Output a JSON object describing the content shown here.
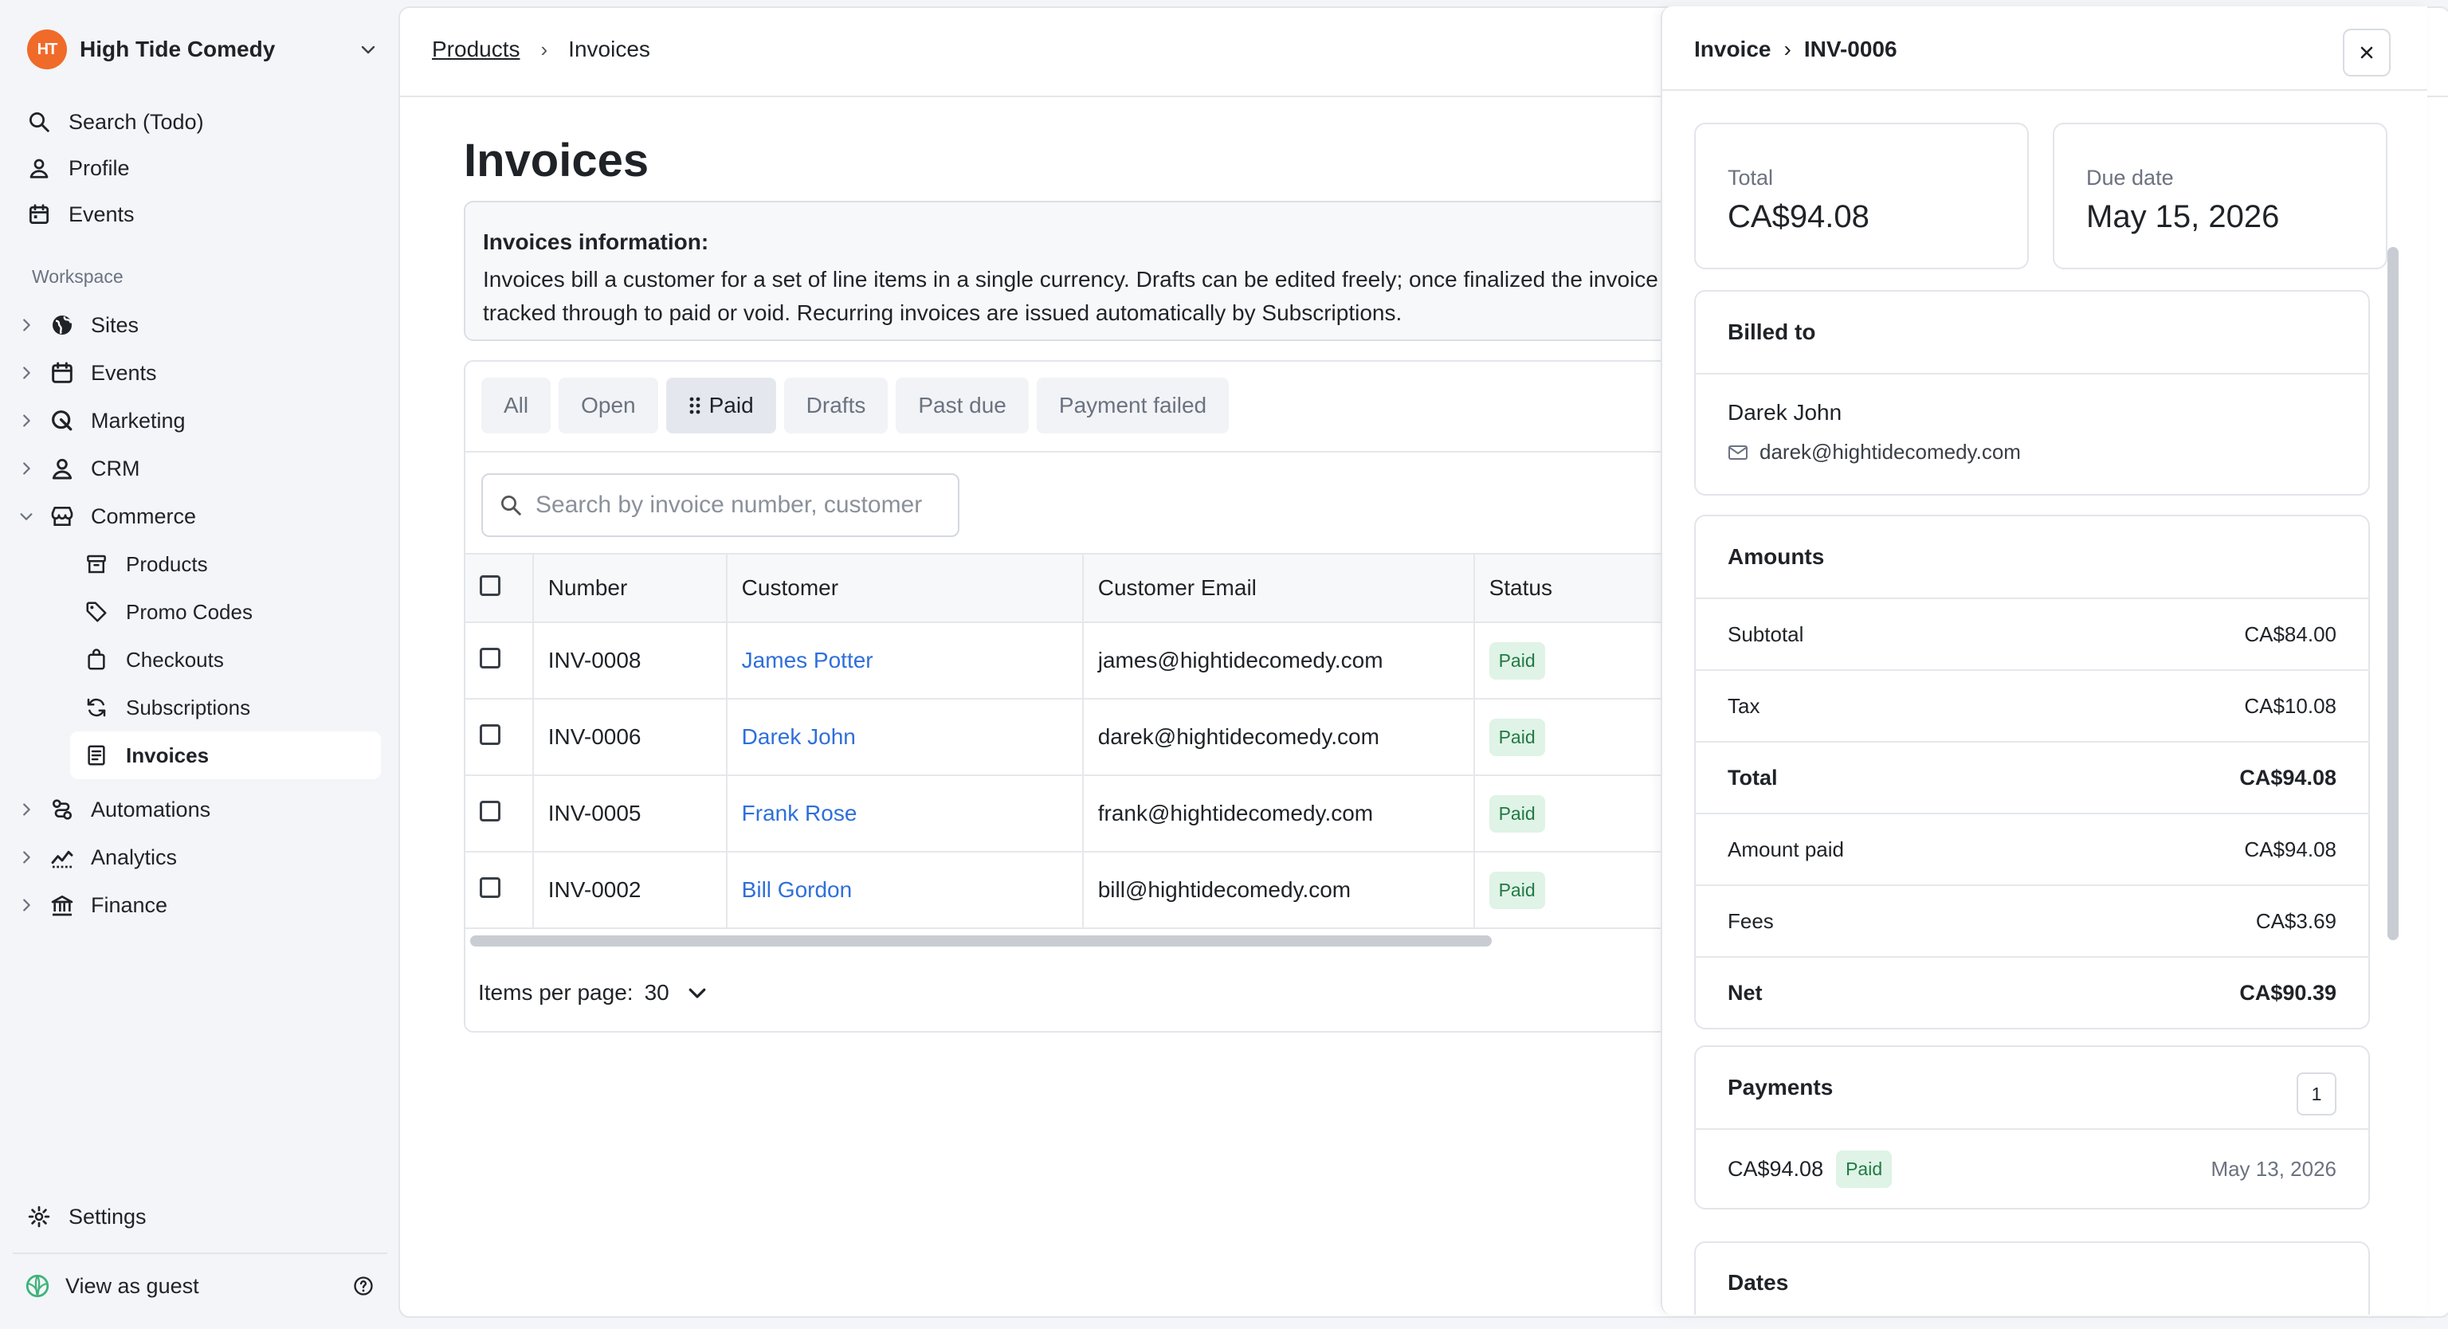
{
  "org": {
    "name": "High Tide Comedy",
    "logo_text": "HT"
  },
  "nav_top": [
    {
      "label": "Search (Todo)",
      "icon": "search-icon"
    },
    {
      "label": "Profile",
      "icon": "user-icon"
    },
    {
      "label": "Events",
      "icon": "calendar-icon"
    }
  ],
  "workspace": {
    "label": "Workspace",
    "items": [
      {
        "label": "Sites",
        "icon": "globe-icon"
      },
      {
        "label": "Events",
        "icon": "calendar-icon"
      },
      {
        "label": "Marketing",
        "icon": "megaphone-icon"
      },
      {
        "label": "CRM",
        "icon": "user-icon"
      },
      {
        "label": "Commerce",
        "icon": "store-icon"
      }
    ],
    "commerce_children": [
      {
        "label": "Products",
        "icon": "box-icon"
      },
      {
        "label": "Promo Codes",
        "icon": "tag-icon"
      },
      {
        "label": "Checkouts",
        "icon": "bag-icon"
      },
      {
        "label": "Subscriptions",
        "icon": "refresh-icon"
      },
      {
        "label": "Invoices",
        "icon": "receipt-icon",
        "active": true
      }
    ],
    "items_after": [
      {
        "label": "Automations",
        "icon": "automation-icon"
      },
      {
        "label": "Analytics",
        "icon": "analytics-icon"
      },
      {
        "label": "Finance",
        "icon": "bank-icon"
      }
    ]
  },
  "settings_label": "Settings",
  "guest_label": "View as guest",
  "breadcrumb": {
    "parent": "Products",
    "current": "Invoices"
  },
  "page_title": "Invoices",
  "info": {
    "heading": "Invoices information:",
    "body": "Invoices bill a customer for a set of line items in a single currency. Drafts can be edited freely; once finalized the invoice is tracked through to paid or void. Recurring invoices are issued automatically by Subscriptions."
  },
  "filters": [
    "All",
    "Open",
    "Paid",
    "Drafts",
    "Past due",
    "Payment failed"
  ],
  "active_filter": "Paid",
  "search_placeholder": "Search by invoice number, customer",
  "table": {
    "headers": [
      "Number",
      "Customer",
      "Customer Email",
      "Status"
    ],
    "rows": [
      {
        "number": "INV-0008",
        "customer": "James Potter",
        "email": "james@hightidecomedy.com",
        "status": "Paid"
      },
      {
        "number": "INV-0006",
        "customer": "Darek John",
        "email": "darek@hightidecomedy.com",
        "status": "Paid"
      },
      {
        "number": "INV-0005",
        "customer": "Frank Rose",
        "email": "frank@hightidecomedy.com",
        "status": "Paid"
      },
      {
        "number": "INV-0002",
        "customer": "Bill Gordon",
        "email": "bill@hightidecomedy.com",
        "status": "Paid"
      }
    ]
  },
  "pager": {
    "label": "Items per page:",
    "value": "30"
  },
  "drawer": {
    "crumb_parent": "Invoice",
    "crumb_current": "INV-0006",
    "total_label": "Total",
    "total_value": "CA$94.08",
    "due_label": "Due date",
    "due_value": "May 15, 2026",
    "billed_title": "Billed to",
    "billed_name": "Darek John",
    "billed_email": "darek@hightidecomedy.com",
    "amounts_title": "Amounts",
    "amounts": [
      {
        "label": "Subtotal",
        "value": "CA$84.00",
        "bold": false
      },
      {
        "label": "Tax",
        "value": "CA$10.08",
        "bold": false
      },
      {
        "label": "Total",
        "value": "CA$94.08",
        "bold": true
      },
      {
        "label": "Amount paid",
        "value": "CA$94.08",
        "bold": false
      },
      {
        "label": "Fees",
        "value": "CA$3.69",
        "bold": false
      },
      {
        "label": "Net",
        "value": "CA$90.39",
        "bold": true
      }
    ],
    "payments_title": "Payments",
    "payments_count": "1",
    "payment": {
      "amount": "CA$94.08",
      "status": "Paid",
      "date": "May 13, 2026"
    },
    "dates_title": "Dates"
  }
}
